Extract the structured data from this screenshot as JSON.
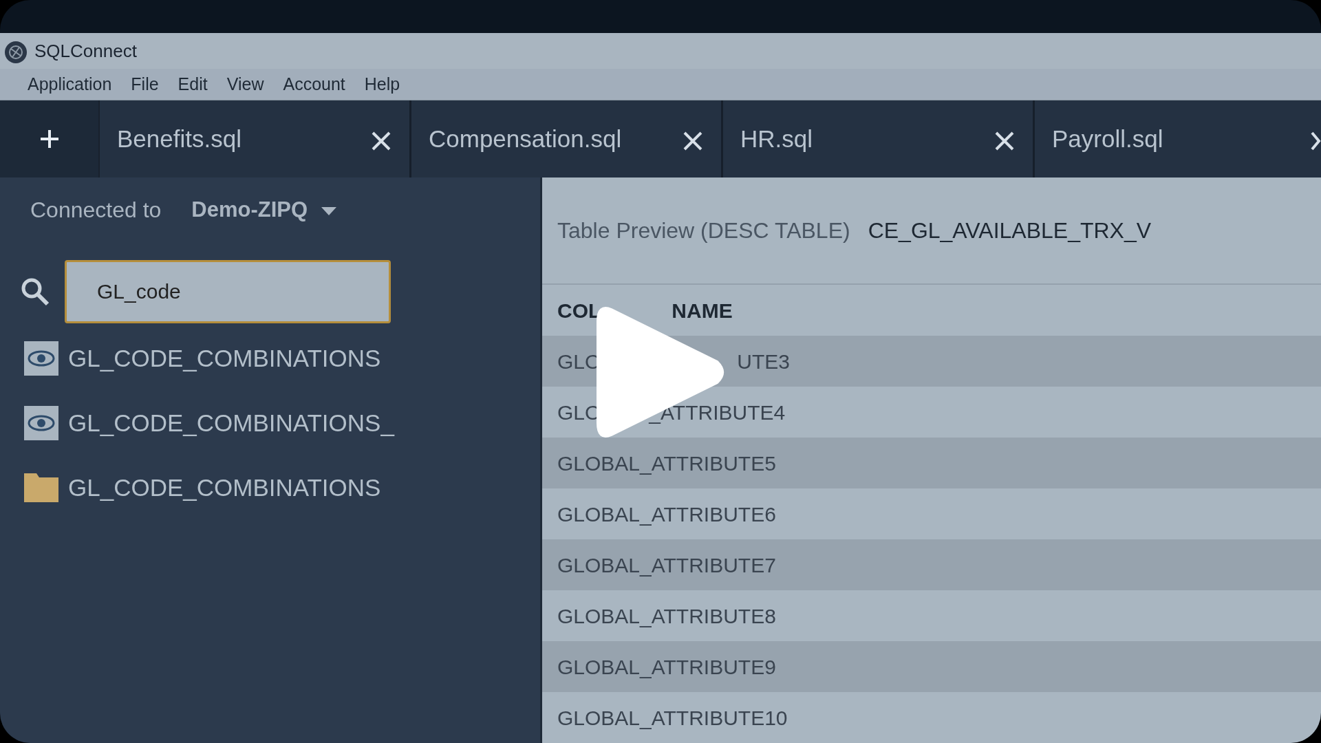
{
  "window": {
    "title": "SQLConnect"
  },
  "menu": [
    "Application",
    "File",
    "Edit",
    "View",
    "Account",
    "Help"
  ],
  "tabs": [
    {
      "label": "Benefits.sql",
      "selected": false
    },
    {
      "label": "Compensation.sql",
      "selected": false
    },
    {
      "label": "HR.sql",
      "selected": false
    },
    {
      "label": "Payroll.sql",
      "selected": false
    }
  ],
  "connection": {
    "label": "Connected to",
    "database": "Demo-ZIPQ"
  },
  "search": {
    "value": "GL_code"
  },
  "results": [
    {
      "kind": "view",
      "label": "GL_CODE_COMBINATIONS"
    },
    {
      "kind": "view",
      "label": "GL_CODE_COMBINATIONS_"
    },
    {
      "kind": "table",
      "label": "GL_CODE_COMBINATIONS"
    }
  ],
  "preview": {
    "label": "Table Preview (DESC TABLE)",
    "table": "CE_GL_AVAILABLE_TRX_V"
  },
  "table": {
    "header": {
      "left": "COL",
      "right": "NAME"
    },
    "rows": [
      {
        "left": "GLO",
        "right": "UTE3"
      },
      {
        "left": "GLO",
        "right": "_ATTRIBUTE4"
      },
      {
        "left": "GLOBAL_ATTRIBUTE5"
      },
      {
        "left": "GLOBAL_ATTRIBUTE6"
      },
      {
        "left": "GLOBAL_ATTRIBUTE7"
      },
      {
        "left": "GLOBAL_ATTRIBUTE8"
      },
      {
        "left": "GLOBAL_ATTRIBUTE9"
      },
      {
        "left": "GLOBAL_ATTRIBUTE10"
      }
    ]
  },
  "player": {
    "kind": "play"
  }
}
